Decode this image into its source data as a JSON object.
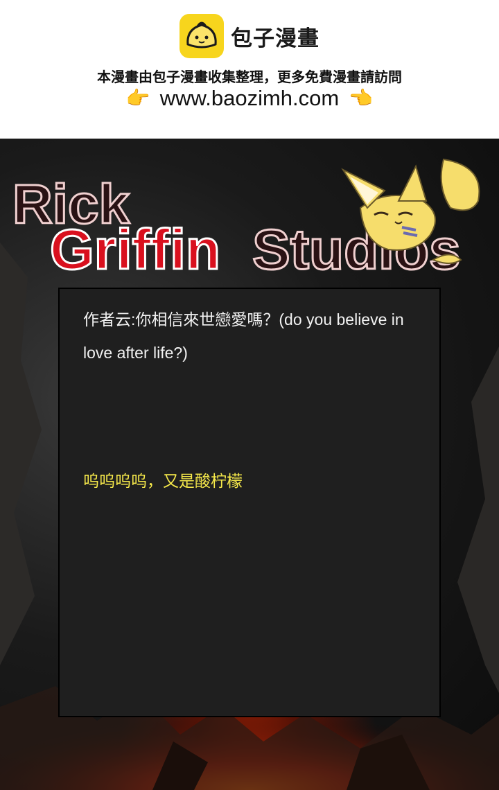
{
  "banner": {
    "brand_name": "包子漫畫",
    "tagline": "本漫畫由包子漫畫收集整理，更多免費漫畫請訪問",
    "url": "www.baozimh.com",
    "left_icon": "pointing-right-hand-icon",
    "right_icon": "pointing-left-hand-icon",
    "logo_color": "#f7d51d"
  },
  "comic": {
    "logo_line1": "Rick",
    "logo_line2_red": "Griffin",
    "logo_line2_dark": "Studios",
    "mascot": "fennec-fox-mascot",
    "author_note": "作者云:你相信來世戀愛嗎？(do you believe in love after life?)",
    "reaction": "呜呜呜呜，又是酸柠檬",
    "reaction_color": "#f5e84a"
  }
}
